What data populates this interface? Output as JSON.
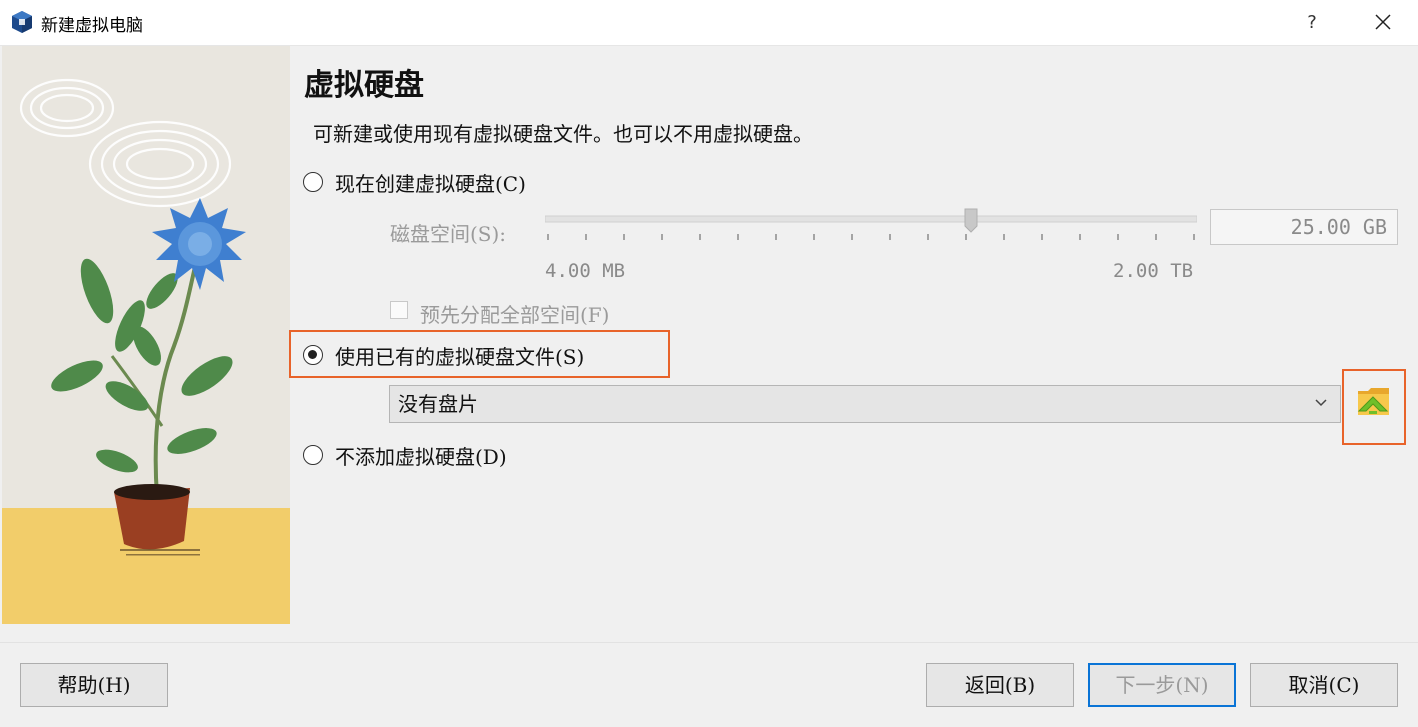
{
  "window": {
    "title": "新建虚拟电脑",
    "help_symbol": "?",
    "close_icon": "close-icon"
  },
  "page": {
    "title": "虚拟硬盘",
    "description": "可新建或使用现有虚拟硬盘文件。也可以不用虚拟硬盘。"
  },
  "options": {
    "create_now": {
      "label": "现在创建虚拟硬盘(C)",
      "checked": false
    },
    "use_existing": {
      "label": "使用已有的虚拟硬盘文件(S)",
      "checked": true
    },
    "no_disk": {
      "label": "不添加虚拟硬盘(D)",
      "checked": false
    }
  },
  "disk_size": {
    "label": "磁盘空间(S):",
    "value": "25.00 GB",
    "min_label": "4.00 MB",
    "max_label": "2.00 TB",
    "slider_fraction": 0.65,
    "enabled": false
  },
  "preallocate": {
    "label": "预先分配全部空间(F)",
    "checked": false,
    "enabled": false
  },
  "existing_disk": {
    "selected": "没有盘片",
    "browse_icon": "folder-browse-icon"
  },
  "buttons": {
    "help": "帮助(H)",
    "back": "返回(B)",
    "next": "下一步(N)",
    "cancel": "取消(C)"
  },
  "colors": {
    "highlight": "#e8632a",
    "focus_border": "#0a74d6"
  }
}
